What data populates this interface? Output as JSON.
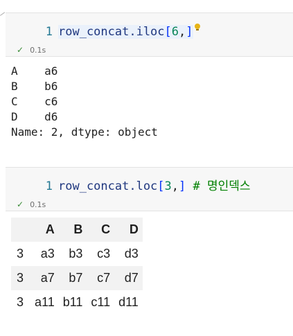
{
  "cell1": {
    "line_number": "1",
    "code": {
      "identifier": "row_concat.iloc",
      "bracket_open": "[",
      "number": "6",
      "comma": ",",
      "bracket_close": "]"
    },
    "status_time": "0.1s"
  },
  "output1": {
    "lines": [
      "A    a6",
      "B    b6",
      "C    c6",
      "D    d6",
      "Name: 2, dtype: object"
    ]
  },
  "cell2": {
    "line_number": "1",
    "code": {
      "identifier": "row_concat.loc",
      "bracket_open": "[",
      "number": "3",
      "comma": ",",
      "bracket_close": "]",
      "comment": " # 명인덱스"
    },
    "status_time": "0.1s"
  },
  "dataframe": {
    "columns": [
      "",
      "A",
      "B",
      "C",
      "D"
    ],
    "rows": [
      [
        "3",
        "a3",
        "b3",
        "c3",
        "d3"
      ],
      [
        "3",
        "a7",
        "b7",
        "c7",
        "d7"
      ],
      [
        "3",
        "a11",
        "b11",
        "c11",
        "d11"
      ]
    ]
  },
  "colors": {
    "success_check": "#388a34",
    "lightbulb": "#e7b416",
    "comment": "#008000",
    "number": "#098658"
  },
  "icons": {
    "status": "check-icon",
    "hint": "lightbulb-icon"
  }
}
